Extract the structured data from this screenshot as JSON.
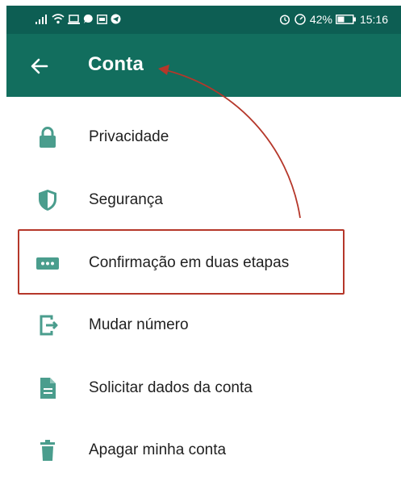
{
  "status_bar": {
    "battery": "42%",
    "time": "15:16"
  },
  "app_bar": {
    "title": "Conta",
    "background": "#126e5e"
  },
  "menu": {
    "items": [
      {
        "label": "Privacidade",
        "icon": "lock-icon"
      },
      {
        "label": "Segurança",
        "icon": "shield-icon"
      },
      {
        "label": "Confirmação em duas etapas",
        "icon": "dots-password-icon"
      },
      {
        "label": "Mudar número",
        "icon": "change-number-icon"
      },
      {
        "label": "Solicitar dados da conta",
        "icon": "document-icon"
      },
      {
        "label": "Apagar minha conta",
        "icon": "trash-icon"
      }
    ]
  },
  "colors": {
    "icon": "#4a9d8d",
    "annotation": "#b5372a"
  }
}
